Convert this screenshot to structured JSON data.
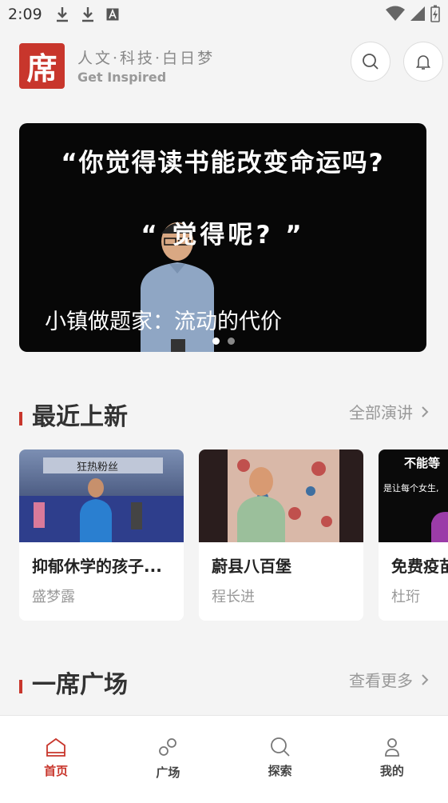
{
  "status_bar": {
    "time": "2:09",
    "icons": [
      "download-icon",
      "download-icon",
      "keyboard-a-icon",
      "wifi-icon",
      "signal-icon",
      "battery-charging-icon"
    ]
  },
  "header": {
    "logo_char": "席",
    "slogan_cn": "人文·科技·白日梦",
    "slogan_en": "Get Inspired"
  },
  "banner": {
    "line1": "“你觉得读书能改变命运吗?",
    "line2": "“ 觉得呢? ”",
    "caption": "小镇做题家：流动的代价",
    "active_slide": 1,
    "slide_count": 2
  },
  "recent": {
    "title": "最近上新",
    "more_label": "全部演讲",
    "cards": [
      {
        "title": "抑郁休学的孩子...",
        "speaker": "盛梦露"
      },
      {
        "title": "蔚县八百堡",
        "speaker": "程长进"
      },
      {
        "title": "免费疫苗",
        "speaker": "杜珩"
      }
    ],
    "card1_overlay": "狂热粉丝",
    "card3_overlay_top": "不能等",
    "card3_overlay_sub": "是让每个女生,"
  },
  "plaza": {
    "title": "一席广场",
    "more_label": "查看更多"
  },
  "nav": {
    "items": [
      {
        "label": "首页",
        "icon": "home-icon",
        "active": true
      },
      {
        "label": "广场",
        "icon": "link-icon",
        "active": false
      },
      {
        "label": "探索",
        "icon": "explore-icon",
        "active": false
      },
      {
        "label": "我的",
        "icon": "user-icon",
        "active": false
      }
    ]
  },
  "colors": {
    "accent": "#c8362c",
    "background": "#f4f4f4",
    "muted": "#999999"
  }
}
